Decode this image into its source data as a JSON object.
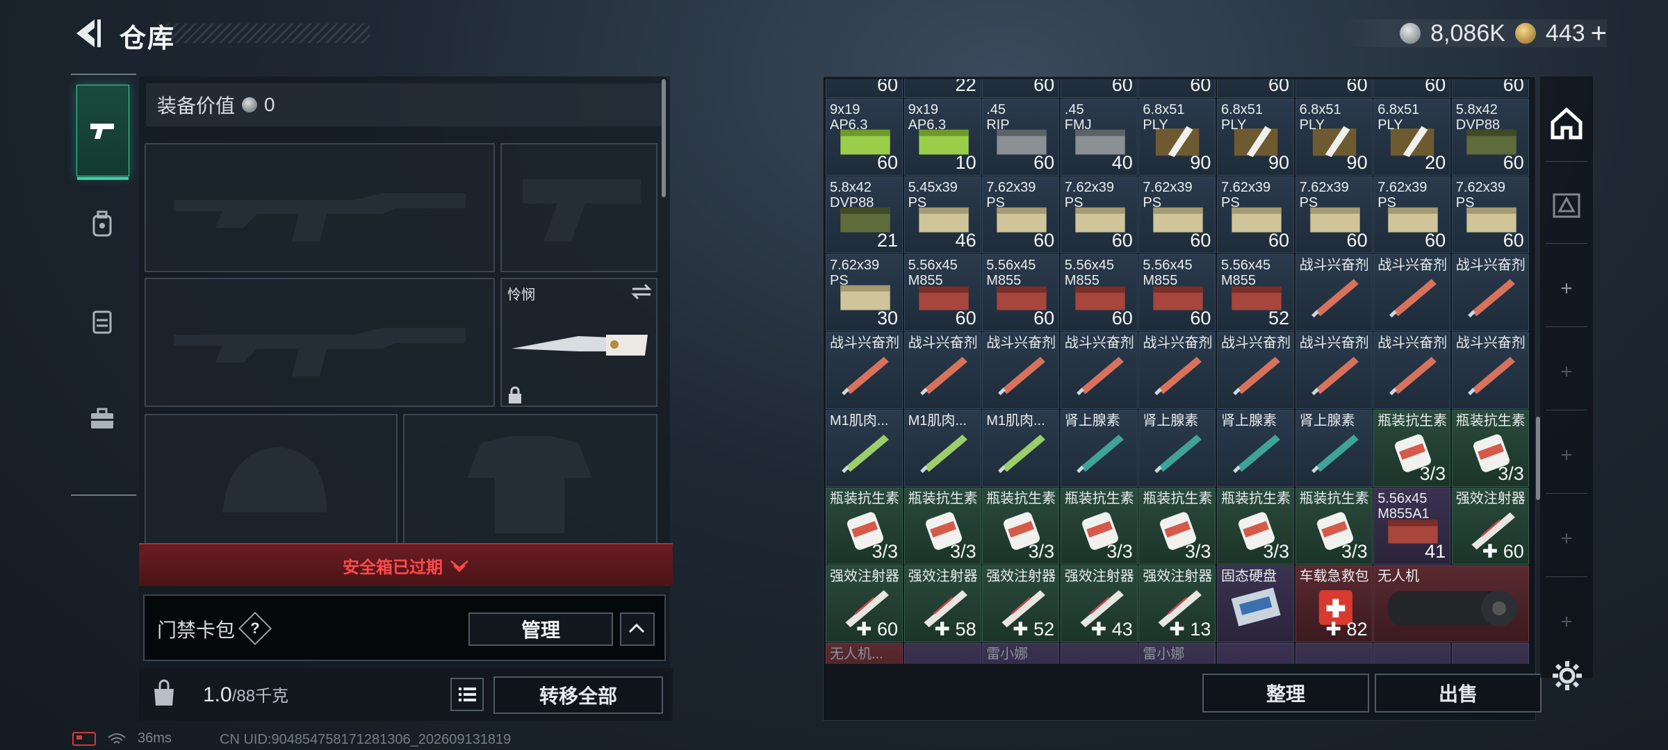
{
  "header": {
    "title": "仓库",
    "silver": "8,086K",
    "gold": "443"
  },
  "loadout": {
    "equip_value_label": "装备价值",
    "equip_value": "0",
    "melee_name": "怜悯",
    "safebox_text": "安全箱已过期",
    "keycard_label": "门禁卡包",
    "keycard_help": "?",
    "manage_label": "管理",
    "weight_current": "1.0",
    "weight_max": "/88千克",
    "transfer_all_label": "转移全部"
  },
  "status": {
    "ping": "36ms",
    "uid": "CN UID:9048547581712813​06_202609131819"
  },
  "stash": {
    "sort_label": "整理",
    "sell_label": "出售",
    "top_counts": [
      "60",
      "22",
      "60",
      "60",
      "60",
      "60",
      "60",
      "60",
      "60"
    ],
    "rows": [
      [
        {
          "n": "9x19\nAP6.3",
          "c": "60",
          "t": "ammo-green"
        },
        {
          "n": "9x19\nAP6.3",
          "c": "10",
          "t": "ammo-green"
        },
        {
          "n": ".45\nRIP",
          "c": "60",
          "t": "ammo-grey"
        },
        {
          "n": ".45\nFMJ",
          "c": "40",
          "t": "ammo-grey"
        },
        {
          "n": "6.8x51\nPLY",
          "c": "90",
          "t": "ammo-white"
        },
        {
          "n": "6.8x51\nPLY",
          "c": "90",
          "t": "ammo-white"
        },
        {
          "n": "6.8x51\nPLY",
          "c": "90",
          "t": "ammo-white"
        },
        {
          "n": "6.8x51\nPLY",
          "c": "20",
          "t": "ammo-white"
        },
        {
          "n": "5.8x42\nDVP88",
          "c": "60",
          "t": "ammo-olive"
        }
      ],
      [
        {
          "n": "5.8x42\nDVP88",
          "c": "21",
          "t": "ammo-olive"
        },
        {
          "n": "5.45x39\nPS",
          "c": "46",
          "t": "ammo-tan"
        },
        {
          "n": "7.62x39\nPS",
          "c": "60",
          "t": "ammo-tan"
        },
        {
          "n": "7.62x39\nPS",
          "c": "60",
          "t": "ammo-tan"
        },
        {
          "n": "7.62x39\nPS",
          "c": "60",
          "t": "ammo-tan"
        },
        {
          "n": "7.62x39\nPS",
          "c": "60",
          "t": "ammo-tan"
        },
        {
          "n": "7.62x39\nPS",
          "c": "60",
          "t": "ammo-tan"
        },
        {
          "n": "7.62x39\nPS",
          "c": "60",
          "t": "ammo-tan"
        },
        {
          "n": "7.62x39\nPS",
          "c": "60",
          "t": "ammo-tan"
        }
      ],
      [
        {
          "n": "7.62x39\nPS",
          "c": "30",
          "t": "ammo-tan"
        },
        {
          "n": "5.56x45\nM855",
          "c": "60",
          "t": "ammo-red"
        },
        {
          "n": "5.56x45\nM855",
          "c": "60",
          "t": "ammo-red"
        },
        {
          "n": "5.56x45\nM855",
          "c": "60",
          "t": "ammo-red"
        },
        {
          "n": "5.56x45\nM855",
          "c": "60",
          "t": "ammo-red"
        },
        {
          "n": "5.56x45\nM855",
          "c": "52",
          "t": "ammo-red"
        },
        {
          "n": "战斗兴奋剂",
          "c": "",
          "t": "syringe-red"
        },
        {
          "n": "战斗兴奋剂",
          "c": "",
          "t": "syringe-red"
        },
        {
          "n": "战斗兴奋剂",
          "c": "",
          "t": "syringe-red"
        }
      ],
      [
        {
          "n": "战斗兴奋剂",
          "c": "",
          "t": "syringe-red"
        },
        {
          "n": "战斗兴奋剂",
          "c": "",
          "t": "syringe-red"
        },
        {
          "n": "战斗兴奋剂",
          "c": "",
          "t": "syringe-red"
        },
        {
          "n": "战斗兴奋剂",
          "c": "",
          "t": "syringe-red"
        },
        {
          "n": "战斗兴奋剂",
          "c": "",
          "t": "syringe-red"
        },
        {
          "n": "战斗兴奋剂",
          "c": "",
          "t": "syringe-red"
        },
        {
          "n": "战斗兴奋剂",
          "c": "",
          "t": "syringe-red"
        },
        {
          "n": "战斗兴奋剂",
          "c": "",
          "t": "syringe-red"
        },
        {
          "n": "战斗兴奋剂",
          "c": "",
          "t": "syringe-red"
        }
      ],
      [
        {
          "n": "M1肌肉...",
          "c": "",
          "t": "syringe-green"
        },
        {
          "n": "M1肌肉...",
          "c": "",
          "t": "syringe-green"
        },
        {
          "n": "M1肌肉...",
          "c": "",
          "t": "syringe-green"
        },
        {
          "n": "肾上腺素",
          "c": "",
          "t": "syringe-teal"
        },
        {
          "n": "肾上腺素",
          "c": "",
          "t": "syringe-teal"
        },
        {
          "n": "肾上腺素",
          "c": "",
          "t": "syringe-teal"
        },
        {
          "n": "肾上腺素",
          "c": "",
          "t": "syringe-teal"
        },
        {
          "n": "瓶装抗生素",
          "c": "3/3",
          "t": "bottle",
          "bg": "green"
        },
        {
          "n": "瓶装抗生素",
          "c": "3/3",
          "t": "bottle",
          "bg": "green"
        }
      ],
      [
        {
          "n": "瓶装抗生素",
          "c": "3/3",
          "t": "bottle",
          "bg": "green"
        },
        {
          "n": "瓶装抗生素",
          "c": "3/3",
          "t": "bottle",
          "bg": "green"
        },
        {
          "n": "瓶装抗生素",
          "c": "3/3",
          "t": "bottle",
          "bg": "green"
        },
        {
          "n": "瓶装抗生素",
          "c": "3/3",
          "t": "bottle",
          "bg": "green"
        },
        {
          "n": "瓶装抗生素",
          "c": "3/3",
          "t": "bottle",
          "bg": "green"
        },
        {
          "n": "瓶装抗生素",
          "c": "3/3",
          "t": "bottle",
          "bg": "green"
        },
        {
          "n": "瓶装抗生素",
          "c": "3/3",
          "t": "bottle",
          "bg": "green"
        },
        {
          "n": "5.56x45\nM855A1",
          "c": "41",
          "t": "ammo-red",
          "bg": "purple"
        },
        {
          "n": "强效注射器",
          "c": "✚ 60",
          "t": "syringe-white",
          "bg": "green"
        }
      ],
      [
        {
          "n": "强效注射器",
          "c": "✚ 60",
          "t": "syringe-white",
          "bg": "green"
        },
        {
          "n": "强效注射器",
          "c": "✚ 58",
          "t": "syringe-white",
          "bg": "green"
        },
        {
          "n": "强效注射器",
          "c": "✚ 52",
          "t": "syringe-white",
          "bg": "green"
        },
        {
          "n": "强效注射器",
          "c": "✚ 43",
          "t": "syringe-white",
          "bg": "green"
        },
        {
          "n": "强效注射器",
          "c": "✚ 13",
          "t": "syringe-white",
          "bg": "green"
        },
        {
          "n": "固态硬盘",
          "c": "",
          "t": "ssd",
          "bg": "purple"
        },
        {
          "n": "车载急救包",
          "c": "✚ 82",
          "t": "medkit",
          "bg": "red"
        },
        {
          "n": "无人机",
          "c": "",
          "t": "drone",
          "bg": "red",
          "big": true
        }
      ]
    ],
    "bottom_labels": [
      "无人机...",
      "",
      "雷小娜",
      "",
      "雷小娜",
      "",
      "",
      "",
      ""
    ]
  }
}
